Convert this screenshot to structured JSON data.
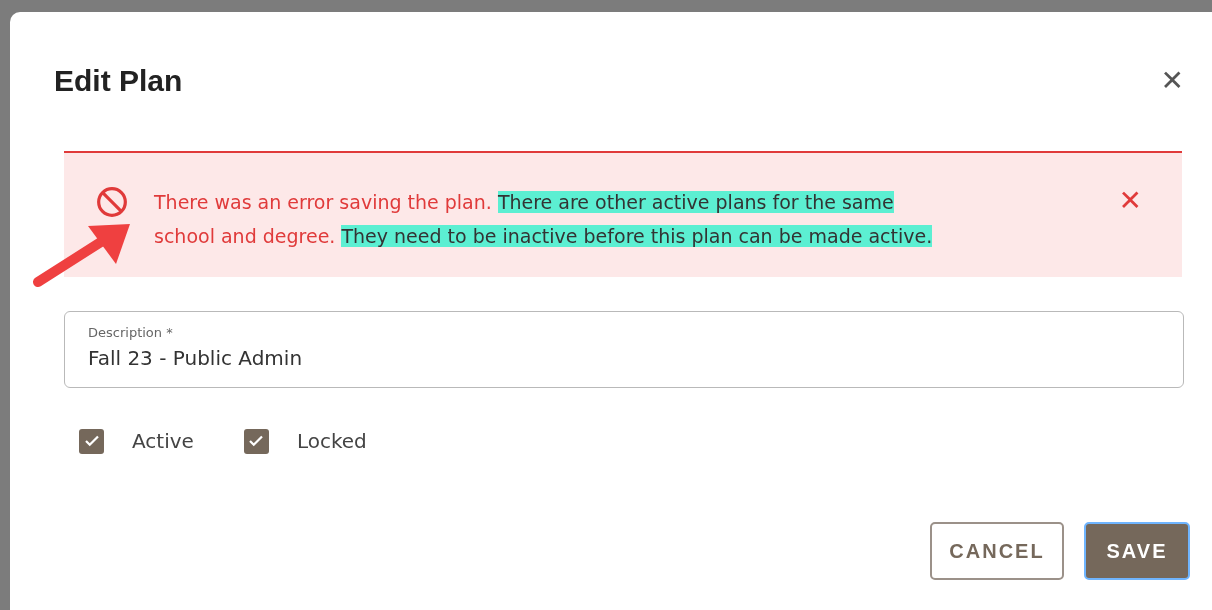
{
  "dialog": {
    "title": "Edit Plan",
    "close_label": "✕"
  },
  "alert": {
    "dismiss_label": "✕",
    "segments": [
      {
        "text": "There was an error saving the plan. ",
        "highlighted": false
      },
      {
        "text": "There are other active plans for the same",
        "highlighted": true
      },
      {
        "text": " school and degree. ",
        "highlighted": false
      },
      {
        "text": "They need to be inactive before this plan can be made active.",
        "highlighted": true
      }
    ]
  },
  "description_field": {
    "label": "Description *",
    "value": "Fall 23 - Public Admin"
  },
  "checkboxes": [
    {
      "label": "Active",
      "checked": true
    },
    {
      "label": "Locked",
      "checked": true
    }
  ],
  "buttons": [
    {
      "label": "CANCEL",
      "kind": "outlined"
    },
    {
      "label": "SAVE",
      "kind": "primary"
    }
  ]
}
